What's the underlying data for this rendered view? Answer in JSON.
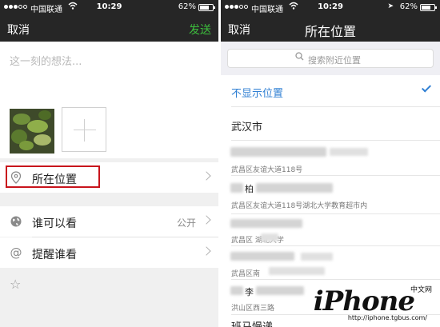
{
  "left": {
    "status": {
      "carrier": "中国联通",
      "time": "10:29",
      "battery": "62%"
    },
    "nav": {
      "cancel": "取消",
      "send": "发送"
    },
    "compose": {
      "placeholder": "这一刻的想法..."
    },
    "rows": {
      "location": "所在位置",
      "visibility": "谁可以看",
      "visibility_value": "公开",
      "mention": "提醒谁看"
    },
    "icons": {
      "location": "map-pin-icon",
      "visibility": "globe-icon",
      "mention": "at-sign-icon",
      "extra": "star-icon"
    },
    "highlight_color": "#c8141c"
  },
  "right": {
    "status": {
      "carrier": "中国联通",
      "time": "10:29",
      "battery": "62%"
    },
    "nav": {
      "cancel": "取消",
      "title": "所在位置"
    },
    "search": {
      "placeholder": "搜索附近位置"
    },
    "locations": [
      {
        "name": "不显示位置",
        "selected": true
      },
      {
        "name": "武汉市"
      },
      {
        "address": "武昌区友谊大道118号"
      },
      {
        "name": "柏",
        "address": "武昌区友谊大道118号湖北大学教育超市内"
      },
      {
        "address": "武昌区 湖北大学"
      },
      {
        "address": "武昌区南"
      },
      {
        "name": "李",
        "address": "洪山区西三路"
      },
      {
        "name": "班马慢递"
      }
    ],
    "accent_color": "#2f7fd3",
    "watermark": {
      "brand": "iPhone",
      "tag": "中文网",
      "url": "http://iphone.tgbus.com/"
    }
  }
}
